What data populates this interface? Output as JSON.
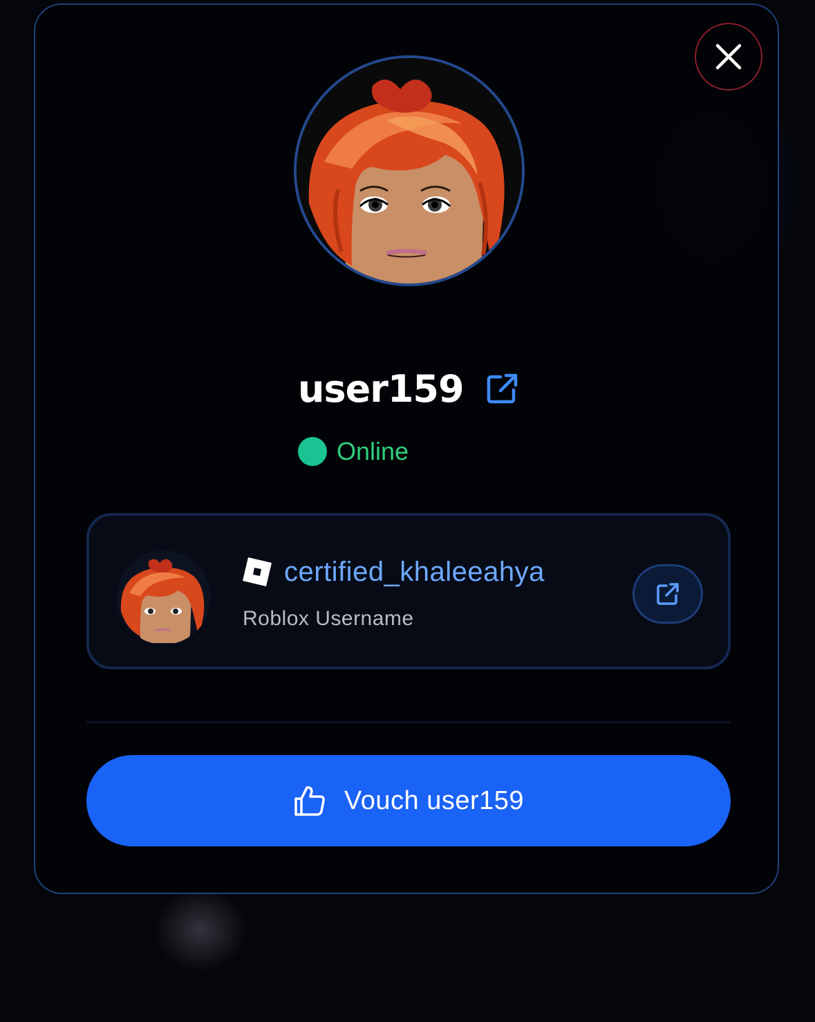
{
  "profile": {
    "username": "user159",
    "status": "Online",
    "status_color": "#19c492"
  },
  "linked_account": {
    "platform_icon": "roblox-logo-icon",
    "username": "certified_khaleeahya",
    "label": "Roblox Username"
  },
  "actions": {
    "vouch_label": "Vouch user159",
    "close_icon": "close-icon",
    "external_link_icon": "external-link-icon",
    "thumbs_up_icon": "thumbs-up-icon"
  },
  "colors": {
    "accent": "#1a63f7",
    "link": "#6ea9ff",
    "close_border": "#8a1e2a",
    "modal_border": "#23407c"
  }
}
